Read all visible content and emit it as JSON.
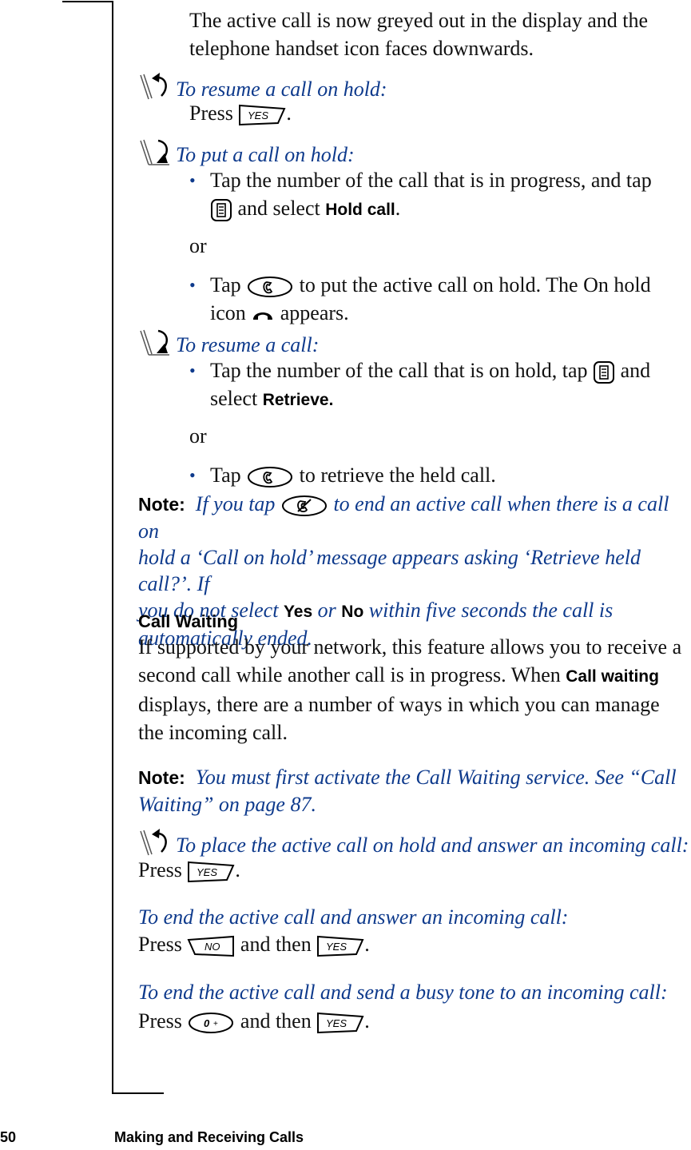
{
  "intro": {
    "line1": "The active call is now greyed out in the display and the",
    "line2": "telephone handset icon faces downwards."
  },
  "sections": {
    "resume_on_hold": {
      "heading": "To resume a call on hold:",
      "press": "Press",
      "key": "YES",
      "end": "."
    },
    "put_on_hold": {
      "heading": "To put a call on hold:",
      "bullet1_a": "Tap the number of the call that is in progress, and tap",
      "bullet1_b": "and select",
      "bullet1_term": "Hold call",
      "bullet1_end": ".",
      "or": "or",
      "bullet2_a": "Tap",
      "bullet2_b": "to put the active call on hold. The On hold",
      "bullet2_c": "icon",
      "bullet2_d": "appears."
    },
    "resume_call": {
      "heading": "To resume a call:",
      "bullet1_a": "Tap the number of the call that is on hold, tap",
      "bullet1_b": "and",
      "bullet1_c": "select",
      "bullet1_term": "Retrieve.",
      "or": "or",
      "bullet2_a": "Tap",
      "bullet2_b": "to retrieve the held call."
    },
    "note1": {
      "label": "Note:",
      "text_a": "If you tap",
      "text_b": "to end an active call when there is a call on",
      "text_c": "hold a ‘Call on hold’ message appears asking ‘Retrieve held call?’. If",
      "text_d": "you do not select",
      "yes": "Yes",
      "or": "or",
      "no": "No",
      "text_e": "within five seconds the call is",
      "text_f": "automatically ended."
    },
    "call_waiting": {
      "heading": "Call Waiting",
      "p1": "If supported by your network, this feature allows you to receive a",
      "p2_a": "second call while another call is in progress. When",
      "p2_term": "Call waiting",
      "p3": "displays, there are a number of ways in which you can manage",
      "p4": "the incoming call."
    },
    "note2": {
      "label": "Note:",
      "text_a": "You must first activate the Call Waiting service. See “Call",
      "text_b": "Waiting” on page 87."
    },
    "place_on_hold_answer": {
      "heading": "To place the active call on hold and answer an incoming call:",
      "press": "Press",
      "key": "YES",
      "end": "."
    },
    "end_and_answer": {
      "heading": "To end the active call and answer an incoming call:",
      "press": "Press",
      "key1": "NO",
      "and_then": "and then",
      "key2": "YES",
      "end": "."
    },
    "end_and_busy": {
      "heading": "To end the active call and send a busy tone to an incoming call:",
      "press": "Press",
      "key1": "0+",
      "and_then": "and then",
      "key2": "YES",
      "end": "."
    }
  },
  "footer": {
    "page_number": "50",
    "chapter": "Making and Receiving Calls"
  },
  "colors": {
    "heading_blue": "#0e3a8c",
    "text": "#111111"
  }
}
